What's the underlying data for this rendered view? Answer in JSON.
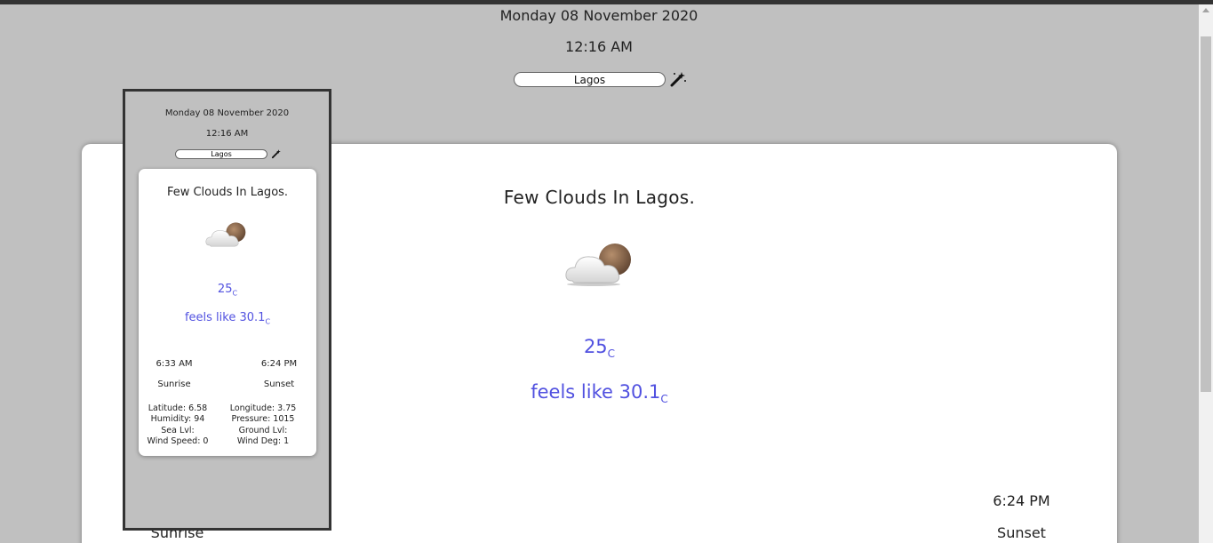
{
  "header": {
    "date": "Monday 08 November 2020",
    "time": "12:16 AM",
    "city_value": "Lagos"
  },
  "weather": {
    "description": "Few Clouds In Lagos.",
    "temp": "25",
    "temp_unit": "C",
    "feels_like": "feels like 30.1",
    "feels_unit": "C",
    "sunrise_time": "6:33 AM",
    "sunrise_label": "Sunrise",
    "sunset_time": "6:24 PM",
    "sunset_label": "Sunset"
  },
  "preview": {
    "date": "Monday 08 November 2020",
    "time": "12:16 AM",
    "city_value": "Lagos",
    "description": "Few Clouds In Lagos.",
    "temp": "25",
    "temp_unit": "C",
    "feels_like": "feels like 30.1",
    "feels_unit": "C",
    "sunrise_time": "6:33 AM",
    "sunset_time": "6:24 PM",
    "sunrise_label": "Sunrise",
    "sunset_label": "Sunset",
    "stats": {
      "latitude": "Latitude: 6.58",
      "longitude": "Longitude: 3.75",
      "humidity": "Humidity: 94",
      "pressure": "Pressure: 1015",
      "sea_level": "Sea Lvl:",
      "ground_level": "Ground Lvl:",
      "wind_speed": "Wind Speed: 0",
      "wind_deg": "Wind Deg: 1"
    }
  },
  "icons": {
    "search": "magic-wand-icon",
    "weather": "few-clouds-night-icon"
  },
  "colors": {
    "background": "#c0c0c0",
    "accent_text": "#5151e0",
    "card": "#ffffff"
  }
}
